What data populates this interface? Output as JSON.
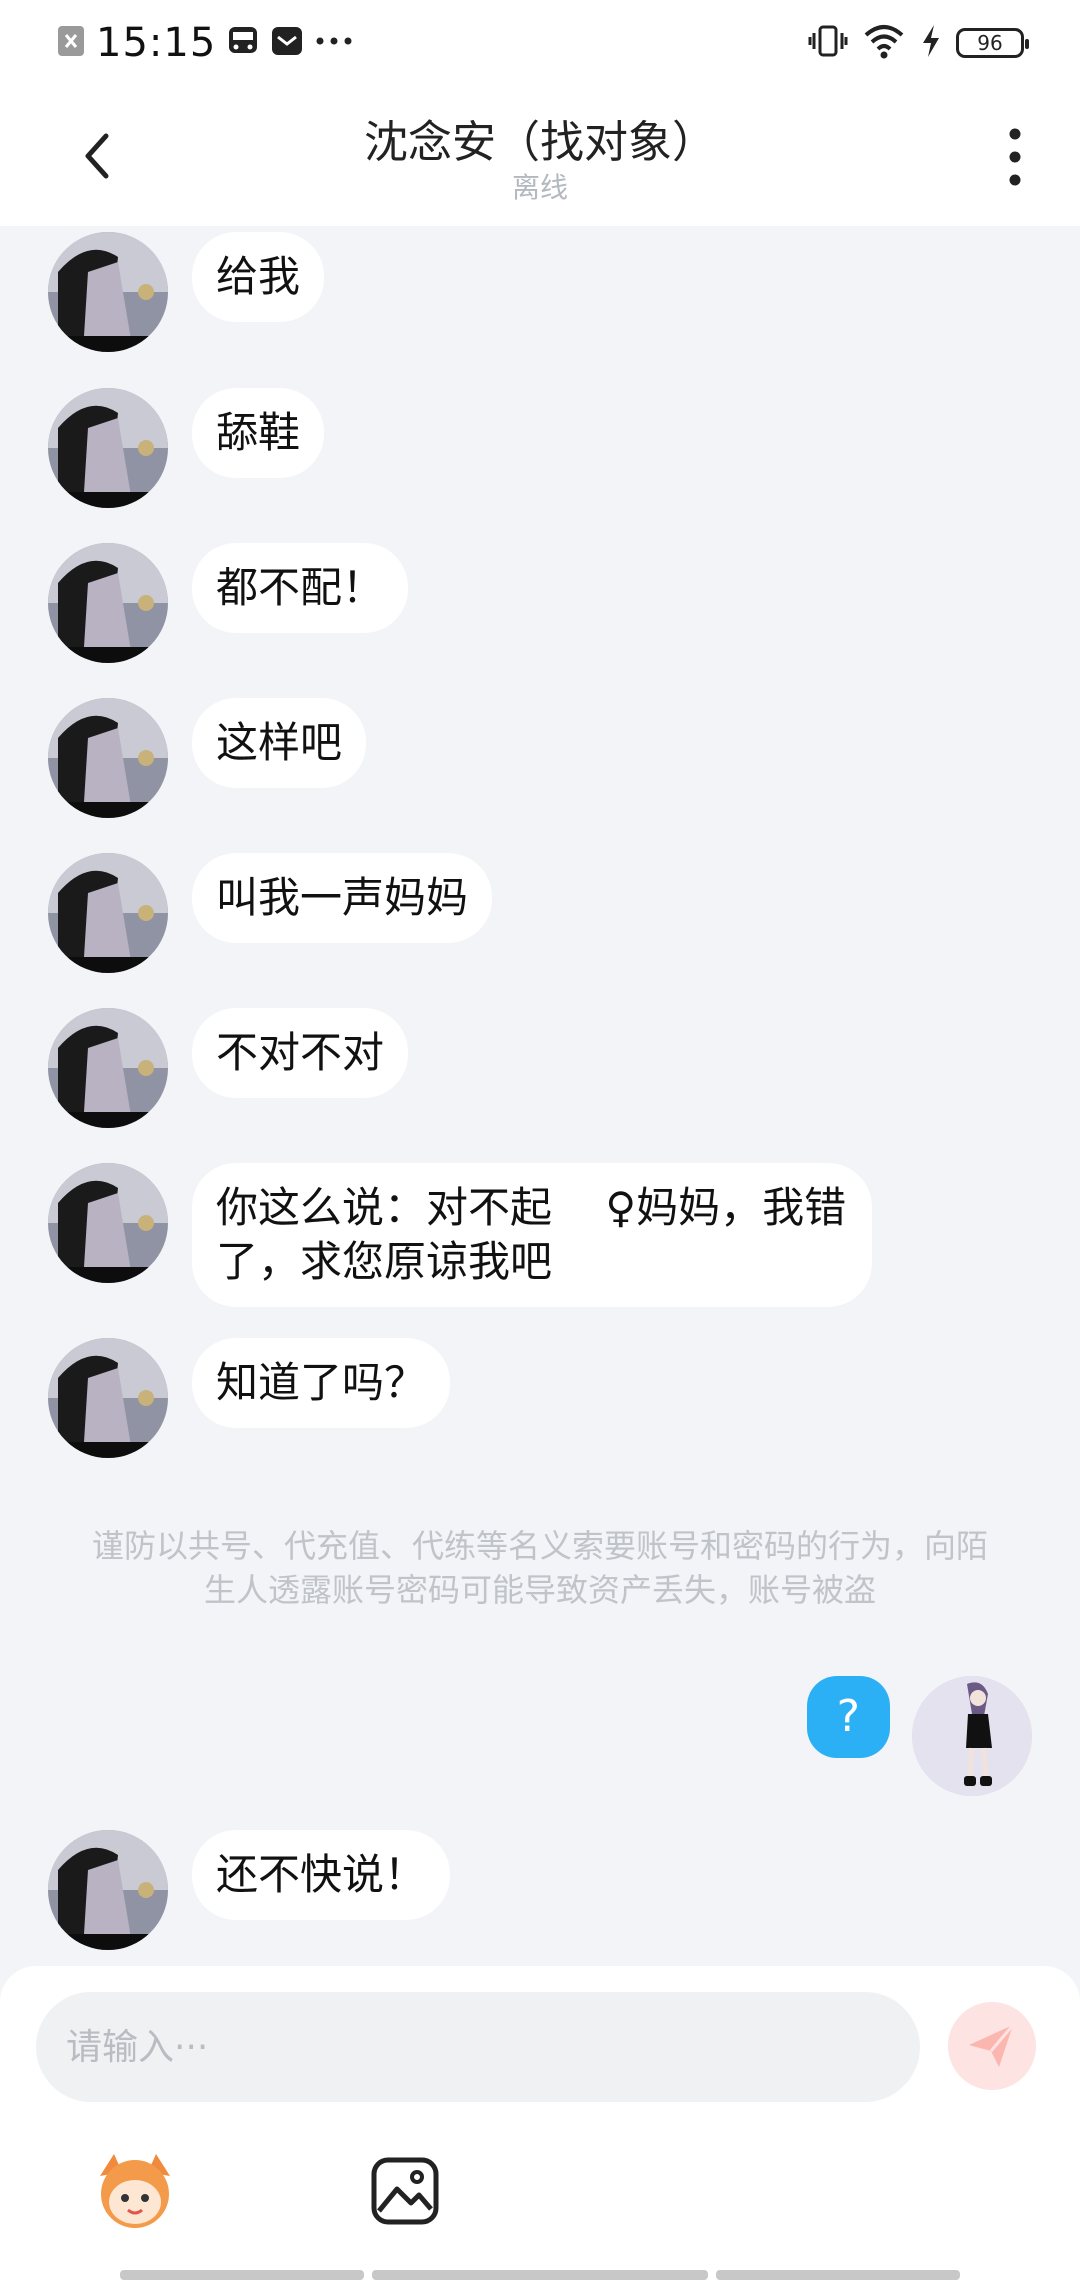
{
  "status_bar": {
    "time": "15:15",
    "battery": "96"
  },
  "header": {
    "title": "沈念安（找对象）",
    "subtitle": "离线"
  },
  "messages": [
    {
      "text": "给我"
    },
    {
      "text": "舔鞋"
    },
    {
      "text": "都不配！"
    },
    {
      "text": "这样吧"
    },
    {
      "text": "叫我一声妈妈"
    },
    {
      "text": "不对不对"
    },
    {
      "text": "你这么说：对不起 ‍ ‍ ‍ ♀妈妈，我错了，求您原谅我吧"
    },
    {
      "text": "知道了吗？"
    }
  ],
  "notice": "谨防以共号、代充值、代练等名义索要账号和密码的行为，向陌生人透露账号密码可能导致资产丢失，账号被盗",
  "my_message": {
    "text": "?"
  },
  "last_message": {
    "text": "还不快说！"
  },
  "composer": {
    "placeholder": "请输入···"
  },
  "colors": {
    "accent": "#2cb0f5",
    "send_button": "#fde3e1",
    "background": "#f2f4f7"
  }
}
